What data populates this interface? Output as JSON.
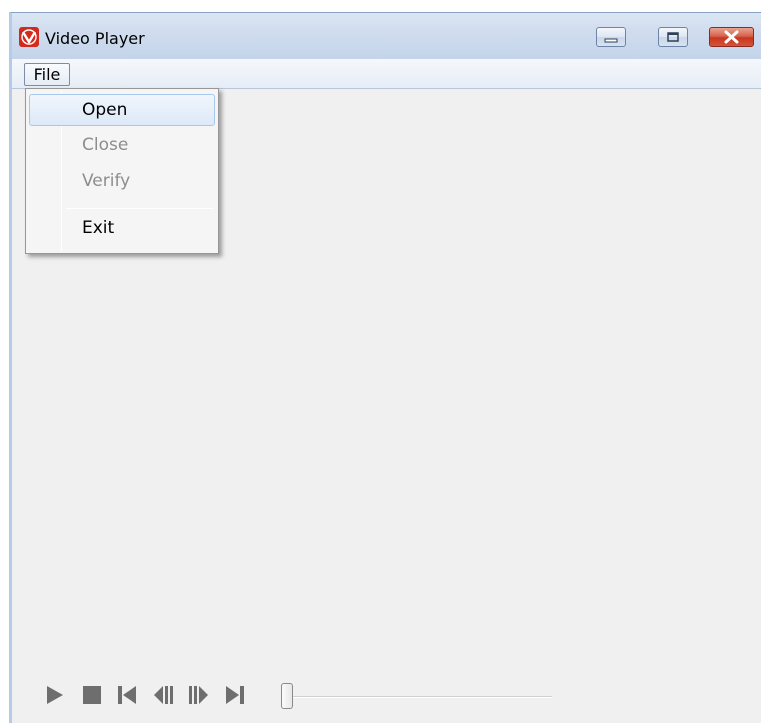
{
  "window": {
    "title": "Video Player"
  },
  "menubar": {
    "file_label": "File"
  },
  "file_menu": {
    "items": [
      {
        "label": "Open",
        "enabled": true,
        "highlighted": true
      },
      {
        "label": "Close",
        "enabled": false,
        "highlighted": false
      },
      {
        "label": "Verify",
        "enabled": false,
        "highlighted": false
      },
      {
        "label": "Exit",
        "enabled": true,
        "highlighted": false
      }
    ]
  },
  "controls": {
    "icons": [
      "play-icon",
      "stop-icon",
      "skip-to-start-icon",
      "step-back-icon",
      "step-forward-icon",
      "skip-to-end-icon"
    ],
    "seek_position": 0
  },
  "colors": {
    "app_icon": "#d42a1e",
    "close_button": "#c7361e",
    "control_icon": "#6e6e6e"
  }
}
